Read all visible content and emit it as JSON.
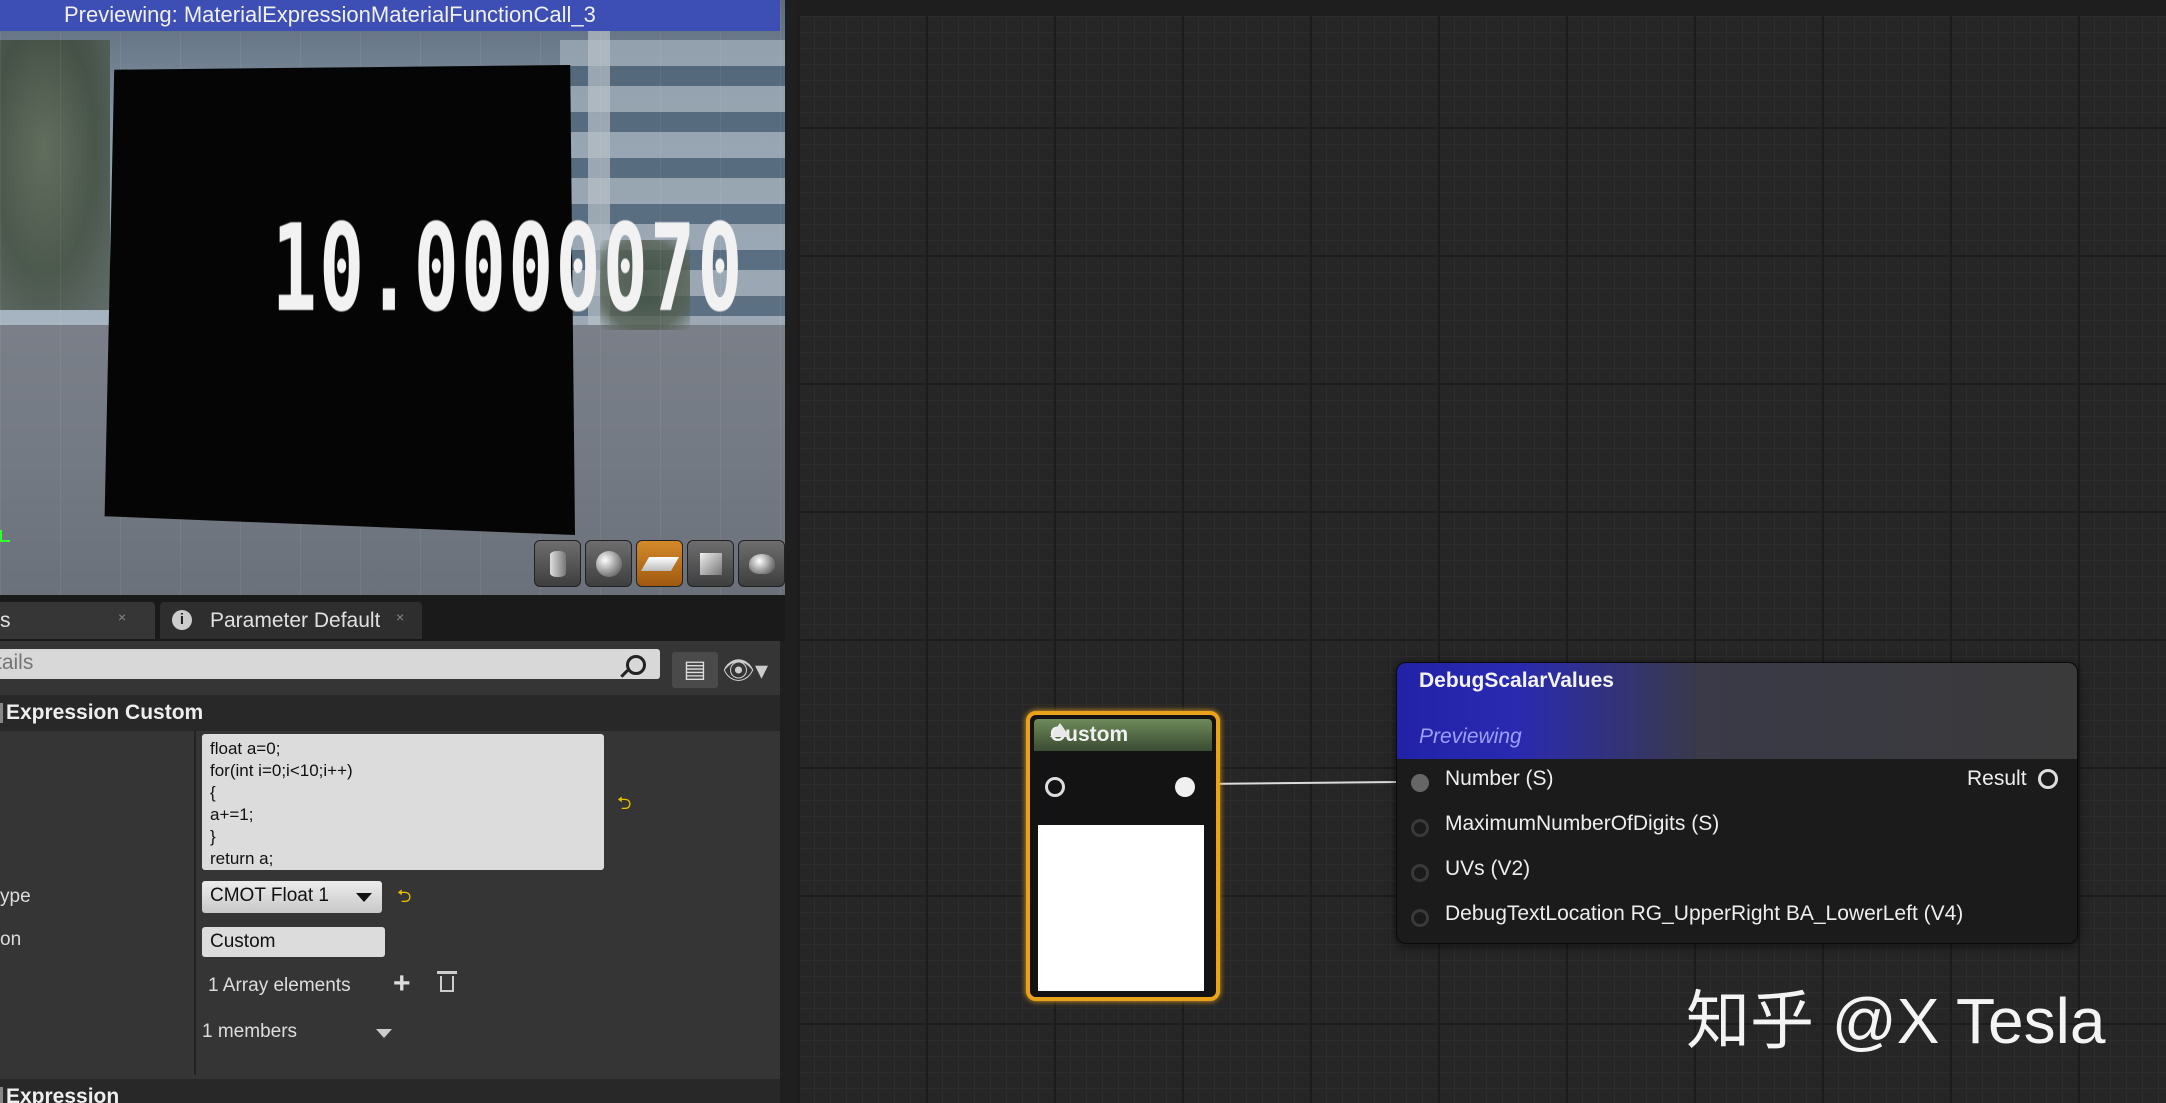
{
  "preview": {
    "title": "Previewing: MaterialExpressionMaterialFunctionCall_3",
    "debug_value": "10.0000070"
  },
  "viewport_toolbar": [
    "cylinder-preview",
    "sphere-preview",
    "plane-preview",
    "cube-preview",
    "teapot-preview"
  ],
  "tabs": {
    "details": {
      "label": "s",
      "close": "×"
    },
    "params": {
      "label": "Parameter Defaults",
      "close": "×"
    }
  },
  "search": {
    "placeholder": "tails"
  },
  "sections": {
    "custom": "Expression Custom",
    "expression": "Expression"
  },
  "properties": {
    "type_label": "ype",
    "desc_label": "on",
    "code": [
      "float a=0;",
      "for(int i=0;i<10;i++)",
      "{",
      "a+=1;",
      "}",
      "return a;"
    ],
    "output_type": "CMOT Float 1",
    "description": "Custom",
    "array": "1 Array elements",
    "members": "1 members"
  },
  "nodes": {
    "custom": {
      "title": "Custom"
    },
    "debug": {
      "title": "DebugScalarValues",
      "subtitle": "Previewing",
      "result": "Result",
      "inputs": [
        "Number (S)",
        "MaximumNumberOfDigits (S)",
        "UVs (V2)",
        "DebugTextLocation RG_UpperRight BA_LowerLeft (V4)"
      ]
    }
  },
  "watermark": "知乎 @X Tesla",
  "colors": {
    "accent_orange": "#e9a21a",
    "node_header_blue": "#2222a8",
    "preview_bar": "#3d4eb5"
  }
}
